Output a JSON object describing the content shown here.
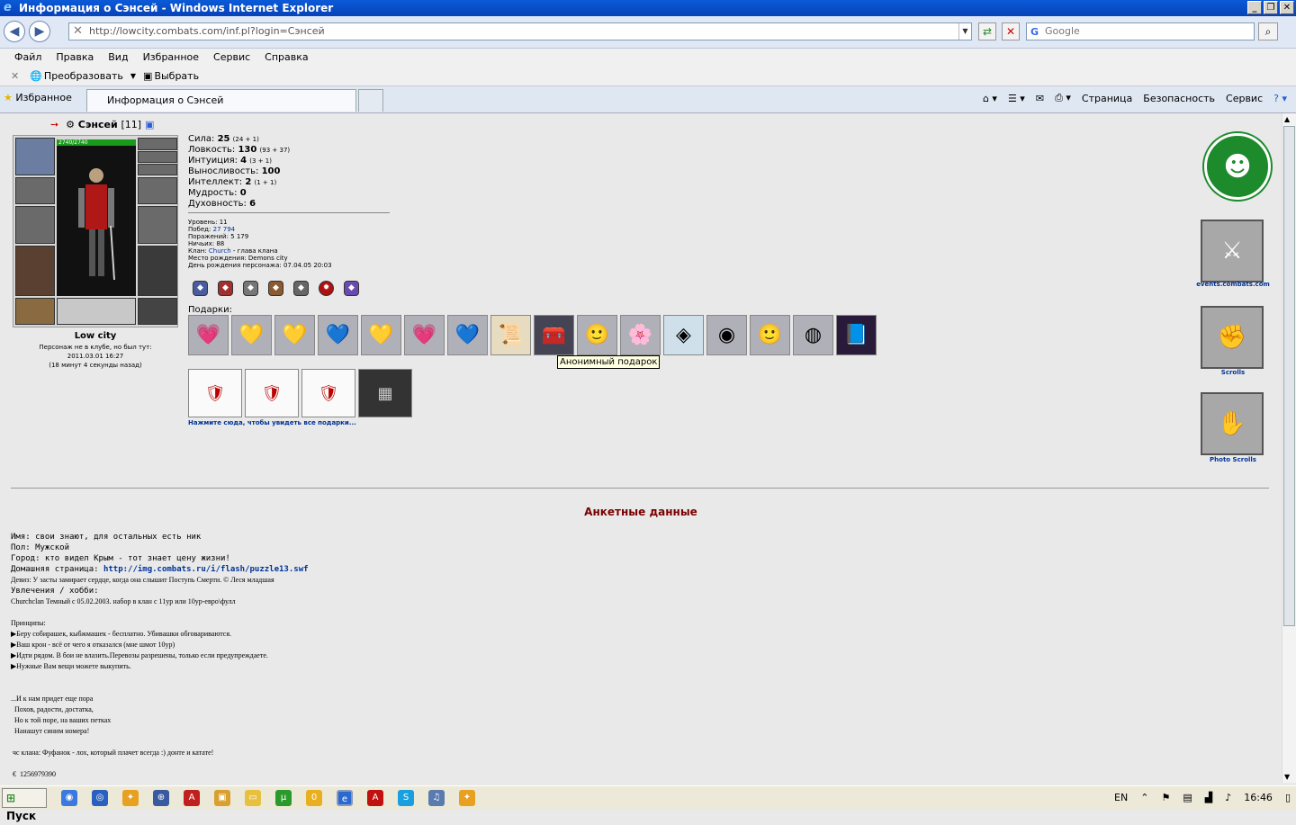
{
  "window": {
    "title": "Информация о Сэнсей - Windows Internet Explorer"
  },
  "address": {
    "url": "http://lowcity.combats.com/inf.pl?login=Сэнсей",
    "search_placeholder": "Google"
  },
  "menu": [
    "Файл",
    "Правка",
    "Вид",
    "Избранное",
    "Сервис",
    "Справка"
  ],
  "toolbar": {
    "convert": "Преобразовать",
    "select": "Выбрать"
  },
  "tabs": {
    "favorites": "Избранное",
    "active": "Информация о Сэнсей"
  },
  "commandbar": {
    "page": "Страница",
    "security": "Безопасность",
    "tools": "Сервис"
  },
  "profile": {
    "nick": "Сэнсей",
    "level": "[11]",
    "hp": "2740/2740",
    "city": "Low city",
    "status": [
      "Персонаж не в клубе, но был тут:",
      "2011.03.01 16:27",
      "(18 минут 4 секунды назад)"
    ],
    "stats": {
      "strength": {
        "label": "Сила:",
        "value": "25",
        "extra": "(24 + 1)"
      },
      "agility": {
        "label": "Ловкость:",
        "value": "130",
        "extra": "(93 + 37)"
      },
      "intuition": {
        "label": "Интуиция:",
        "value": "4",
        "extra": "(3 + 1)"
      },
      "endurance": {
        "label": "Выносливость:",
        "value": "100"
      },
      "intellect": {
        "label": "Интеллект:",
        "value": "2",
        "extra": "(1 + 1)"
      },
      "wisdom": {
        "label": "Мудрость:",
        "value": "0"
      },
      "spirit": {
        "label": "Духовность:",
        "value": "6"
      }
    },
    "details": {
      "level": "Уровень: 11",
      "wins_label": "Побед:",
      "wins": "27 794",
      "losses": "Поражений: 5 179",
      "draws": "Ничьих: 88",
      "clan_label": "Клан:",
      "clan": "Church",
      "clan_role": " - глава клана",
      "birthplace": "Место рождения: Demons city",
      "birthday": "День рождения персонажа: 07.04.05 20:03"
    },
    "gifts_label": "Подарки:",
    "gifts_tooltip": "Анонимный подарок",
    "all_gifts": "Нажмите сюда, чтобы увидеть все подарки..."
  },
  "side": {
    "events": "events.combats.com",
    "scrolls": "Scrolls",
    "photo": "Photo Scrolls"
  },
  "anketa": {
    "title": "Анкетные данные",
    "name": "Имя: свои знают, для остальных есть ник",
    "sex": "Пол: Мужской",
    "town": "Город: кто видел Крым - тот знает цену жизни!",
    "home_label": "Домашняя страница: ",
    "home": "http://img.combats.ru/i/flash/puzzle13.swf",
    "motto": "Девиз: У засты замирает сердце, когда она слышит Поступь Смерти. © Леся младшая",
    "hobby": "Увлечения / хобби:",
    "lines": [
      "Churchclan Темный с 05.02.2003. набор в клан с 11ур или 10ур-евро\\фулл",
      "",
      "Принципы:",
      "▶Беру собирашек, кыбжмашек - бесплатно. Убивашки обговариваются.",
      "▶Ваш крон - всё от чего я отказался (мне шмот 10ур)",
      "▶Идти рядом. В бои не влазить.Перевозы разрешены, только если предупреждаете.",
      "▶Нужные Вам вещи можете выкупить.",
      "",
      "",
      "...И к нам придет еще пора",
      "  Похов, радости, достатка,",
      "  Но к той поре, на ваших петках",
      "  Нанашут синим номера!",
      "",
      " чс клана: Фуфанок - лох, который плачет всегда :) донте и катате!",
      "",
      " €  1256979390"
    ]
  },
  "taskbar": {
    "start": "Пуск",
    "lang": "EN",
    "time": "16:46"
  }
}
